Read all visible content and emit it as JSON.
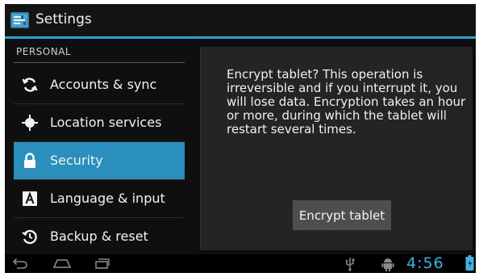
{
  "app": {
    "title": "Settings",
    "icon": "settings-icon"
  },
  "sidebar": {
    "section_header": "PERSONAL",
    "items": [
      {
        "label": "Accounts & sync",
        "icon": "sync-icon",
        "selected": false
      },
      {
        "label": "Location services",
        "icon": "location-icon",
        "selected": false
      },
      {
        "label": "Security",
        "icon": "lock-icon",
        "selected": true
      },
      {
        "label": "Language & input",
        "icon": "keyboard-icon",
        "selected": false
      },
      {
        "label": "Backup & reset",
        "icon": "backup-icon",
        "selected": false
      }
    ]
  },
  "dialog": {
    "message": "Encrypt tablet? This operation is irreversible and if you interrupt it, you will lose data. Encryption takes an hour or more, during which the tablet will restart several times.",
    "button_label": "Encrypt tablet"
  },
  "system_bar": {
    "time": "4:56",
    "icons": [
      "back-icon",
      "home-icon",
      "recent-apps-icon",
      "usb-icon",
      "android-debug-icon",
      "battery-icon"
    ]
  },
  "colors": {
    "accent": "#2aa2cf",
    "selected": "#2b8fbd",
    "clock": "#3fb2e0"
  }
}
